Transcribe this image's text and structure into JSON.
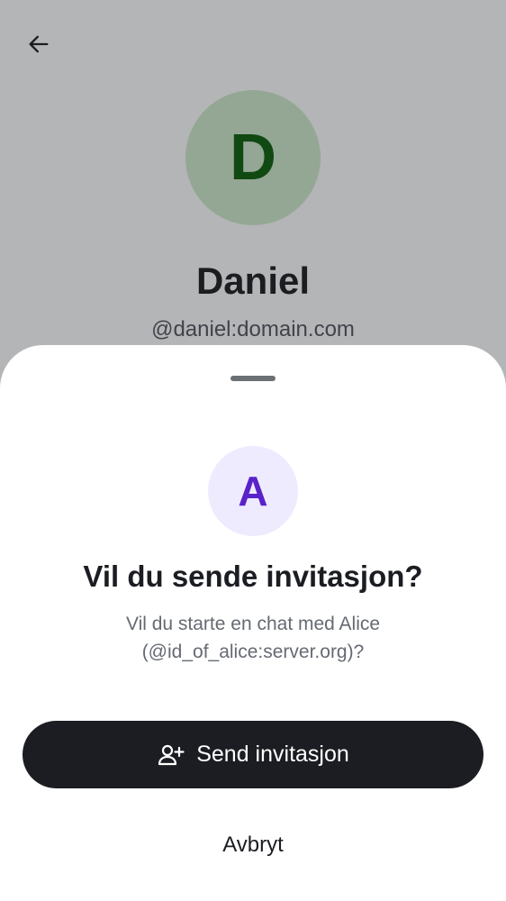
{
  "profile": {
    "back_icon": "arrow-left-icon",
    "avatar_initial": "D",
    "name": "Daniel",
    "user_id": "@daniel:domain.com"
  },
  "dialog": {
    "avatar_initial": "A",
    "title": "Vil du sende invitasjon?",
    "message": "Vil du starte en chat med Alice (@id_of_alice:server.org)?",
    "primary_icon": "person-add-icon",
    "primary_label": "Send invitasjon",
    "cancel_label": "Avbryt"
  },
  "colors": {
    "profile_avatar_bg": "#cfe9cc",
    "profile_avatar_text": "#0b5f0b",
    "dialog_avatar_bg": "#efebff",
    "dialog_avatar_text": "#5a22c9",
    "primary_button_bg": "#1b1d22"
  }
}
